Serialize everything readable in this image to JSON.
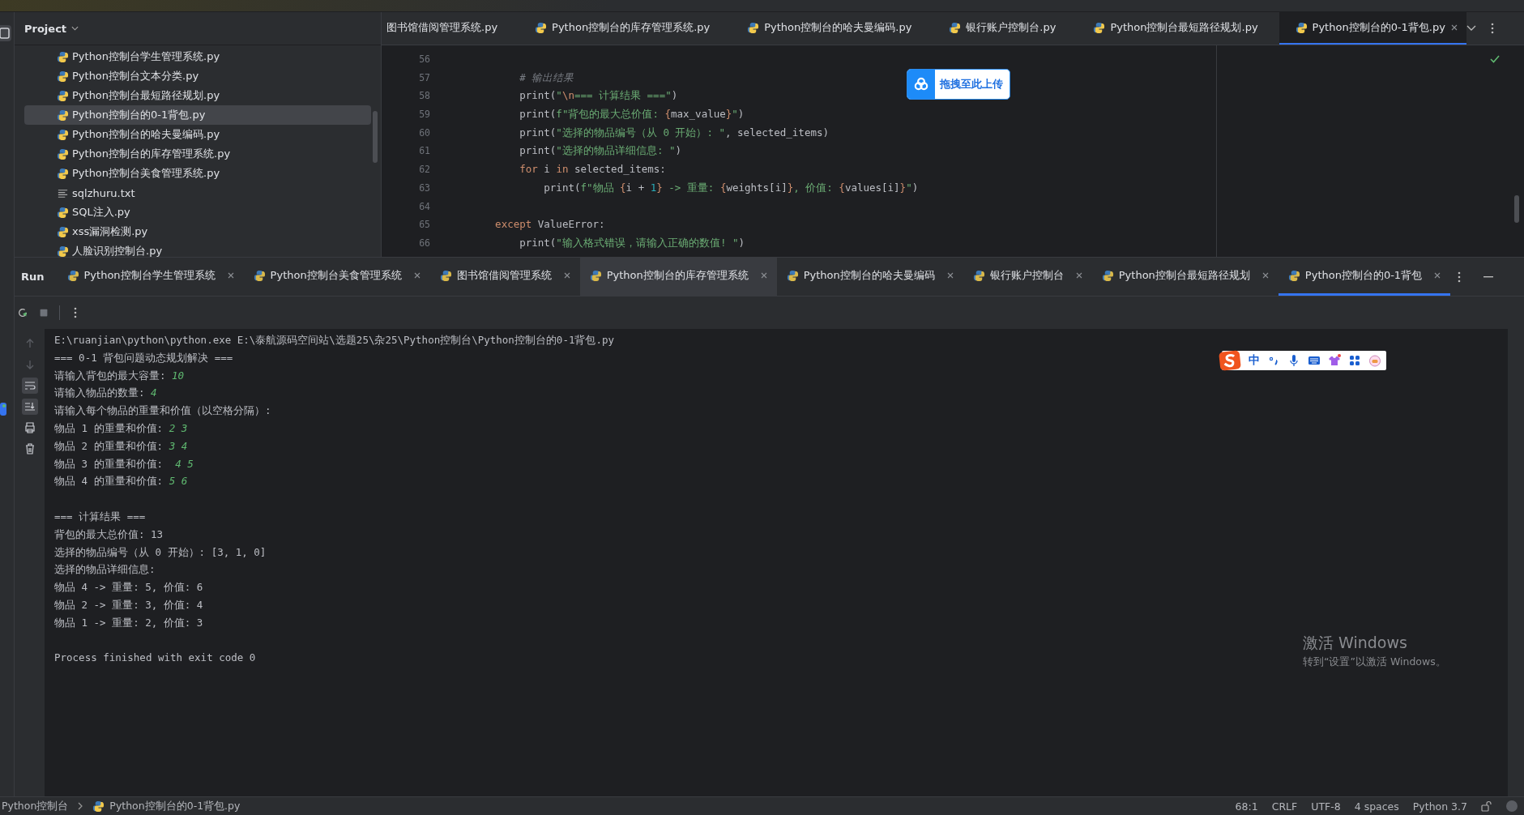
{
  "project": {
    "title": "Project",
    "items": [
      {
        "label": "Python控制台学生管理系统.py",
        "kind": "python",
        "selected": false
      },
      {
        "label": "Python控制台文本分类.py",
        "kind": "python",
        "selected": false
      },
      {
        "label": "Python控制台最短路径规划.py",
        "kind": "python",
        "selected": false
      },
      {
        "label": "Python控制台的0-1背包.py",
        "kind": "python",
        "selected": true
      },
      {
        "label": "Python控制台的哈夫曼编码.py",
        "kind": "python",
        "selected": false
      },
      {
        "label": "Python控制台的库存管理系统.py",
        "kind": "python",
        "selected": false
      },
      {
        "label": "Python控制台美食管理系统.py",
        "kind": "python",
        "selected": false
      },
      {
        "label": "sqlzhuru.txt",
        "kind": "text",
        "selected": false
      },
      {
        "label": "SQL注入.py",
        "kind": "python",
        "selected": false
      },
      {
        "label": "xss漏洞检测.py",
        "kind": "python",
        "selected": false
      },
      {
        "label": "人脸识别控制台.py",
        "kind": "python",
        "selected": false
      }
    ]
  },
  "editor_tabs": [
    {
      "label": "图书馆借阅管理系统.py",
      "icon": false,
      "selected": false
    },
    {
      "label": "Python控制台的库存管理系统.py",
      "icon": true,
      "selected": false
    },
    {
      "label": "Python控制台的哈夫曼编码.py",
      "icon": true,
      "selected": false
    },
    {
      "label": "银行账户控制台.py",
      "icon": true,
      "selected": false
    },
    {
      "label": "Python控制台最短路径规划.py",
      "icon": true,
      "selected": false
    },
    {
      "label": "Python控制台的0-1背包.py",
      "icon": true,
      "selected": true
    }
  ],
  "code_lines": [
    {
      "n": "56"
    },
    {
      "n": "57",
      "segs": [
        {
          "t": "        # 输出结果",
          "kind": "comment"
        }
      ]
    },
    {
      "n": "58",
      "segs": [
        {
          "t": "        print(",
          "kind": "plain"
        },
        {
          "t": "\"",
          "kind": "str"
        },
        {
          "t": "\\n",
          "kind": "esc"
        },
        {
          "t": "=== 计算结果 ===\"",
          "kind": "str"
        },
        {
          "t": ")",
          "kind": "plain"
        }
      ]
    },
    {
      "n": "59",
      "segs": [
        {
          "t": "        print(",
          "kind": "plain"
        },
        {
          "t": "f\"背包的最大总价值: ",
          "kind": "str"
        },
        {
          "t": "{",
          "kind": "esc"
        },
        {
          "t": "max_value",
          "kind": "plain"
        },
        {
          "t": "}",
          "kind": "esc"
        },
        {
          "t": "\"",
          "kind": "str"
        },
        {
          "t": ")",
          "kind": "plain"
        }
      ]
    },
    {
      "n": "60",
      "segs": [
        {
          "t": "        print(",
          "kind": "plain"
        },
        {
          "t": "\"选择的物品编号（从 0 开始）: \"",
          "kind": "str"
        },
        {
          "t": ", selected_items)",
          "kind": "plain"
        }
      ]
    },
    {
      "n": "61",
      "segs": [
        {
          "t": "        print(",
          "kind": "plain"
        },
        {
          "t": "\"选择的物品详细信息: \"",
          "kind": "str"
        },
        {
          "t": ")",
          "kind": "plain"
        }
      ]
    },
    {
      "n": "62",
      "segs": [
        {
          "t": "        for",
          "kind": "kw"
        },
        {
          "t": " i ",
          "kind": "plain"
        },
        {
          "t": "in",
          "kind": "kw"
        },
        {
          "t": " selected_items:",
          "kind": "plain"
        }
      ]
    },
    {
      "n": "63",
      "segs": [
        {
          "t": "            print(",
          "kind": "plain"
        },
        {
          "t": "f\"物品 ",
          "kind": "str"
        },
        {
          "t": "{",
          "kind": "esc"
        },
        {
          "t": "i + ",
          "kind": "plain"
        },
        {
          "t": "1",
          "kind": "num"
        },
        {
          "t": "}",
          "kind": "esc"
        },
        {
          "t": " -> 重量: ",
          "kind": "str"
        },
        {
          "t": "{",
          "kind": "esc"
        },
        {
          "t": "weights[i]",
          "kind": "plain"
        },
        {
          "t": "}",
          "kind": "esc"
        },
        {
          "t": ", 价值: ",
          "kind": "str"
        },
        {
          "t": "{",
          "kind": "esc"
        },
        {
          "t": "values[i]",
          "kind": "plain"
        },
        {
          "t": "}",
          "kind": "esc"
        },
        {
          "t": "\"",
          "kind": "str"
        },
        {
          "t": ")",
          "kind": "plain"
        }
      ]
    },
    {
      "n": "64"
    },
    {
      "n": "65",
      "segs": [
        {
          "t": "    except",
          "kind": "kw"
        },
        {
          "t": " ValueError:",
          "kind": "plain"
        }
      ]
    },
    {
      "n": "66",
      "segs": [
        {
          "t": "        print(",
          "kind": "plain"
        },
        {
          "t": "\"输入格式错误，请输入正确的数值! \"",
          "kind": "str"
        },
        {
          "t": ")",
          "kind": "plain"
        }
      ]
    }
  ],
  "upload_badge": {
    "label": "拖拽至此上传"
  },
  "run": {
    "title": "Run",
    "tabs": [
      {
        "label": "Python控制台学生管理系统",
        "selected": false,
        "hovered": false
      },
      {
        "label": "Python控制台美食管理系统",
        "selected": false,
        "hovered": false
      },
      {
        "label": "图书馆借阅管理系统",
        "selected": false,
        "hovered": false
      },
      {
        "label": "Python控制台的库存管理系统",
        "selected": false,
        "hovered": true
      },
      {
        "label": "Python控制台的哈夫曼编码",
        "selected": false,
        "hovered": false
      },
      {
        "label": "银行账户控制台",
        "selected": false,
        "hovered": false
      },
      {
        "label": "Python控制台最短路径规划",
        "selected": false,
        "hovered": false
      },
      {
        "label": "Python控制台的0-1背包",
        "selected": true,
        "hovered": false
      }
    ],
    "console": [
      {
        "kind": "line",
        "segs": [
          {
            "t": "E:\\ruanjian\\python\\python.exe E:\\泰航源码空间站\\选题25\\杂25\\Python控制台\\Python控制台的0-1背包.py",
            "kind": "out"
          }
        ]
      },
      {
        "kind": "line",
        "segs": [
          {
            "t": "=== 0-1 背包问题动态规划解决 ===",
            "kind": "out"
          }
        ]
      },
      {
        "kind": "line",
        "segs": [
          {
            "t": "请输入背包的最大容量: ",
            "kind": "out"
          },
          {
            "t": "10",
            "kind": "in"
          }
        ]
      },
      {
        "kind": "line",
        "segs": [
          {
            "t": "请输入物品的数量: ",
            "kind": "out"
          },
          {
            "t": "4",
            "kind": "in"
          }
        ]
      },
      {
        "kind": "line",
        "segs": [
          {
            "t": "请输入每个物品的重量和价值（以空格分隔）:",
            "kind": "out"
          }
        ]
      },
      {
        "kind": "line",
        "segs": [
          {
            "t": "物品 1 的重量和价值: ",
            "kind": "out"
          },
          {
            "t": "2 3",
            "kind": "in"
          }
        ]
      },
      {
        "kind": "line",
        "segs": [
          {
            "t": "物品 2 的重量和价值: ",
            "kind": "out"
          },
          {
            "t": "3 4",
            "kind": "in"
          }
        ]
      },
      {
        "kind": "line",
        "segs": [
          {
            "t": "物品 3 的重量和价值: ",
            "kind": "out"
          },
          {
            "t": " 4 5",
            "kind": "in"
          }
        ]
      },
      {
        "kind": "line",
        "segs": [
          {
            "t": "物品 4 的重量和价值: ",
            "kind": "out"
          },
          {
            "t": "5 6",
            "kind": "in"
          }
        ]
      },
      {
        "kind": "blank"
      },
      {
        "kind": "line",
        "segs": [
          {
            "t": "=== 计算结果 ===",
            "kind": "out"
          }
        ]
      },
      {
        "kind": "line",
        "segs": [
          {
            "t": "背包的最大总价值: 13",
            "kind": "out"
          }
        ]
      },
      {
        "kind": "line",
        "segs": [
          {
            "t": "选择的物品编号（从 0 开始）: [3, 1, 0]",
            "kind": "out"
          }
        ]
      },
      {
        "kind": "line",
        "segs": [
          {
            "t": "选择的物品详细信息:",
            "kind": "out"
          }
        ]
      },
      {
        "kind": "line",
        "segs": [
          {
            "t": "物品 4 -> 重量: 5, 价值: 6",
            "kind": "out"
          }
        ]
      },
      {
        "kind": "line",
        "segs": [
          {
            "t": "物品 2 -> 重量: 3, 价值: 4",
            "kind": "out"
          }
        ]
      },
      {
        "kind": "line",
        "segs": [
          {
            "t": "物品 1 -> 重量: 2, 价值: 3",
            "kind": "out"
          }
        ]
      },
      {
        "kind": "blank"
      },
      {
        "kind": "line",
        "segs": [
          {
            "t": "Process finished with exit code 0",
            "kind": "out"
          }
        ]
      }
    ]
  },
  "ime_bar": {
    "mode": "中"
  },
  "activation": {
    "title": "激活 Windows",
    "subtitle": "转到“设置”以激活 Windows。"
  },
  "breadcrumb": [
    "Python控制台",
    "Python控制台的0-1背包.py"
  ],
  "status_bar": [
    "68:1",
    "CRLF",
    "UTF-8",
    "4 spaces",
    "Python 3.7"
  ]
}
